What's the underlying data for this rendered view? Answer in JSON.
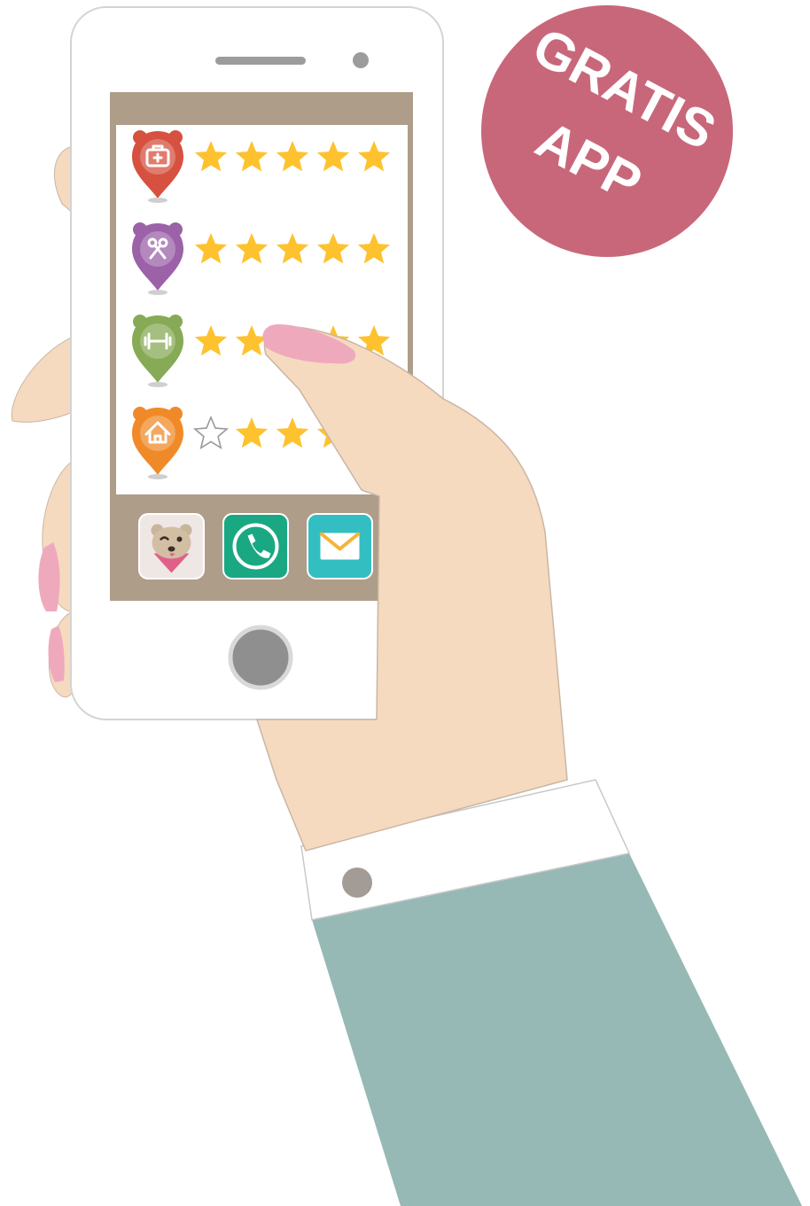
{
  "badge": {
    "line1": "GRATIS",
    "line2": "APP",
    "color": "#c9677a"
  },
  "colors": {
    "skin": "#f5dac0",
    "sleeve": "#96b9b5",
    "cuff": "#ffffff",
    "nail": "#efa9bd",
    "phone_body": "#ffffff",
    "screen_frame": "#ae9d89",
    "star": "#fdc22e"
  },
  "rating_rows": [
    {
      "icon": "first-aid-kit-icon",
      "pin_color": "#d6513f",
      "rating": 5
    },
    {
      "icon": "scissors-comb-icon",
      "pin_color": "#9b62a8",
      "rating": 5
    },
    {
      "icon": "dumbbell-icon",
      "pin_color": "#86aa55",
      "rating": 5
    },
    {
      "icon": "house-icon",
      "pin_color": "#f08a28",
      "rating": 4
    }
  ],
  "dock": [
    {
      "icon": "bear-mascot-icon",
      "color": "#efe7e4"
    },
    {
      "icon": "phone-call-icon",
      "color": "#1aa883"
    },
    {
      "icon": "mail-icon",
      "color": "#33bfc2"
    }
  ]
}
